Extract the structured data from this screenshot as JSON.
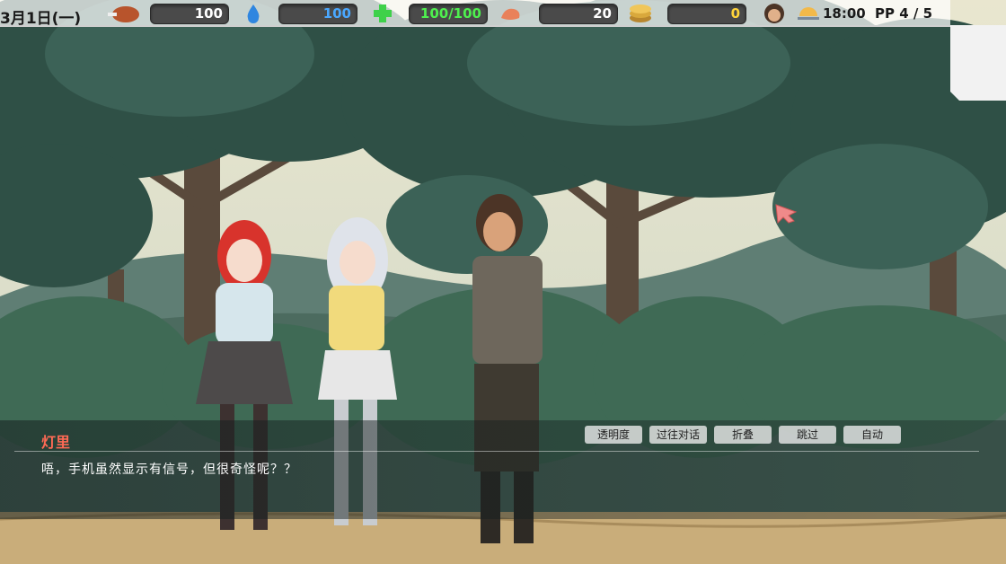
{
  "hud": {
    "date": "3月1日(一)",
    "food": "100",
    "water": "100",
    "health": "100/100",
    "strength": "20",
    "money": "0",
    "time": "18:00",
    "pp": "PP 4 / 5"
  },
  "colors": {
    "food_value": "#ffffff",
    "water_value": "#4aa8ff",
    "health_value": "#4ef04e",
    "strength_value": "#ffffff",
    "money_value": "#ffd43a",
    "speaker": "#ff6a55"
  },
  "icons": [
    "meat-icon",
    "water-drop-icon",
    "health-cross-icon",
    "arm-strength-icon",
    "coins-icon",
    "player-avatar-icon",
    "sunset-icon"
  ],
  "dialog": {
    "speaker": "灯里",
    "text": "唔，手机虽然显示有信号，但很奇怪呢？？",
    "buttons": [
      "透明度",
      "过往对话",
      "折叠",
      "跳过",
      "自动"
    ]
  }
}
